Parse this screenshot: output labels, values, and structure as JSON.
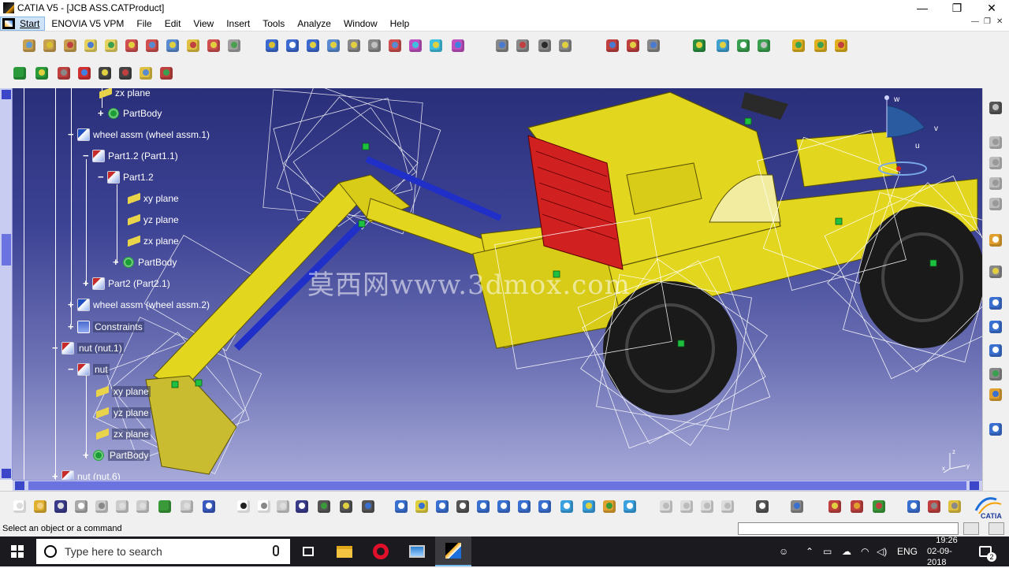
{
  "window": {
    "title": "CATIA V5 - [JCB ASS.CATProduct]",
    "controls": [
      "minimize-icon",
      "restore-icon",
      "close-icon"
    ]
  },
  "menu": {
    "items": [
      "Start",
      "ENOVIA V5 VPM",
      "File",
      "Edit",
      "View",
      "Insert",
      "Tools",
      "Analyze",
      "Window",
      "Help"
    ]
  },
  "tree": {
    "nodes": [
      {
        "label": "zx plane",
        "icon": "plane-icon"
      },
      {
        "label": "PartBody",
        "icon": "partbody-icon"
      },
      {
        "label": "wheel assm (wheel assm.1)",
        "icon": "product-icon"
      },
      {
        "label": "Part1.2 (Part1.1)",
        "icon": "part-icon"
      },
      {
        "label": "Part1.2",
        "icon": "part-icon"
      },
      {
        "label": "xy plane",
        "icon": "plane-icon"
      },
      {
        "label": "yz plane",
        "icon": "plane-icon"
      },
      {
        "label": "zx plane",
        "icon": "plane-icon"
      },
      {
        "label": "PartBody",
        "icon": "partbody-icon"
      },
      {
        "label": "Part2 (Part2.1)",
        "icon": "part-icon"
      },
      {
        "label": "wheel assm (wheel assm.2)",
        "icon": "product-icon"
      },
      {
        "label": "Constraints",
        "icon": "constraints-icon"
      },
      {
        "label": "nut (nut.1)",
        "icon": "part-icon"
      },
      {
        "label": "nut",
        "icon": "part-icon"
      },
      {
        "label": "xy plane",
        "icon": "plane-icon"
      },
      {
        "label": "yz plane",
        "icon": "plane-icon"
      },
      {
        "label": "zx plane",
        "icon": "plane-icon"
      },
      {
        "label": "PartBody",
        "icon": "partbody-icon"
      },
      {
        "label": "nut (nut.6)",
        "icon": "part-icon"
      }
    ]
  },
  "compass": {
    "u": "u",
    "v": "v",
    "w": "w"
  },
  "axis_triad": {
    "x": "x",
    "y": "y",
    "z": "z"
  },
  "watermark": "莫西网www.3dmox.com",
  "brand": "CATIA",
  "status": {
    "message": "Select an object or a command"
  },
  "taskbar": {
    "search_placeholder": "Type here to search",
    "language": "ENG",
    "time": "19:26",
    "date": "02-09-2018",
    "notifications": "2"
  },
  "colors": {
    "background_top": "#2a2f7a",
    "background_bottom": "#a6a9d8",
    "model_yellow": "#e3d61f",
    "model_red": "#d02020",
    "cylinder_blue": "#1f2fc8",
    "scrollbar": "#6b73e0"
  }
}
